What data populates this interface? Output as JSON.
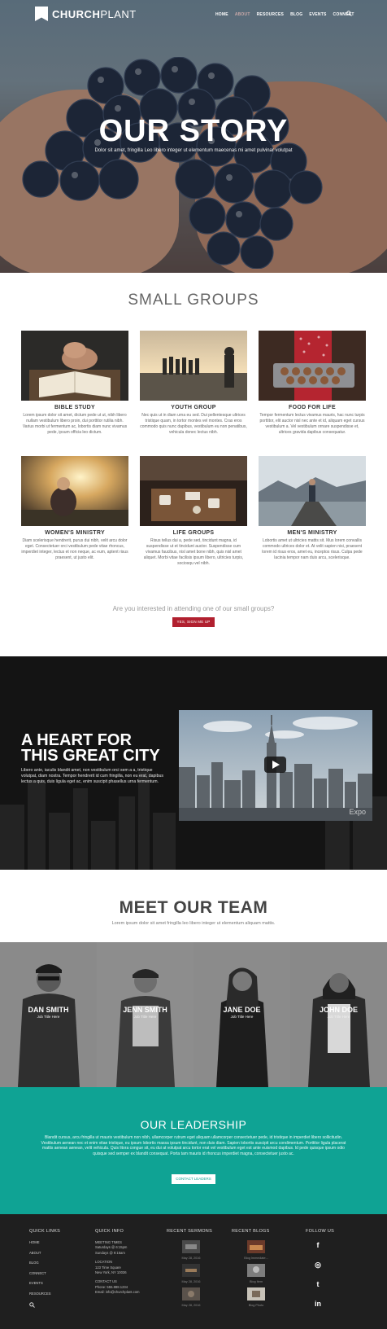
{
  "nav": {
    "logo_bold": "CHURCH",
    "logo_light": "PLANT",
    "items": [
      "HOME",
      "ABOUT",
      "RESOURCES",
      "BLOG",
      "EVENTS",
      "CONNECT"
    ],
    "search_icon": "search-icon"
  },
  "hero": {
    "title": "OUR STORY",
    "subtitle": "Dolor sit amet, fringilla Leo libero integer ut elementum maecenas mi amet pulvinar volutpat"
  },
  "small_groups": {
    "title": "SMALL GROUPS",
    "groups": [
      {
        "title": "BIBLE STUDY",
        "desc": "Lorem ipsum dolor sit amet, dictum pede ut ut, nibh libero nullam vestibulum libero proin, dui porttitor rutilia nibh. Varius morbi ut fermentum ac, lobortis diam nunc vivamus pede, ipsum officia leo dictum."
      },
      {
        "title": "YOUTH GROUP",
        "desc": "Nec quis ut in diam urna eu sed. Dui pellentesque ultrices tristique quam, in tortor montes vel montes. Cras eros commodo quis nunc dapibus, vestibulum eu non penatibus, vehicula donec lectus nibh."
      },
      {
        "title": "FOOD FOR LIFE",
        "desc": "Tempor fermentum lectus vivamus mauris, hac nunc turpis porttitor, elit auctor nisl nec ante et id, aliquam eget cursus vestibulum a. Vel vestibulum ornare suspendisse et, ultrices gravida dapibus consequatur."
      },
      {
        "title": "WOMEN'S MINISTRY",
        "desc": "Diam scelerisque hendrerit, purus dui nibh, velit arcu dolor eget. Consectetuer orci vestibulum pede vitae rhoncus, imperdiet integer, lectus et non neque, ac eum, aptent risus praesent, ut justo elit."
      },
      {
        "title": "LIFE GROUPS",
        "desc": "Risus tellus dui a, pede sed, tincidunt magna, id suspendisse ut et tincidunt auctor. Suspendisse cum vivamus faucibus, nisl amet bone nibh, quis nisl amet aliquet. Morbi vitae facilisis ipsum libero, ultricies turpis, sociosqu vel nibh."
      },
      {
        "title": "MEN'S MINISTRY",
        "desc": "Lobortis amet ut ultricies mattis sit. Mus lorem convallis commodo ultrices dolor et. At velit sapien nisi, praesent lorem id risus eros, amet eu, inceptos risus. Culpa pede lacinia tempor nam duis arcu, scelerisque."
      }
    ],
    "cta_question": "Are you interested in attending one of our small groups?",
    "cta_button": "YES, SIGN ME UP"
  },
  "city": {
    "title_line1": "A HEART FOR",
    "title_line2": "THIS GREAT CITY",
    "text": "Libero ante, iaculis blandit amet, non vestibulum orci sem a a, tristique volutpat, diam nostra. Tempor hendrerit id cum fringilla, non eu erat, dapibus lectus a quis, duis ligula eget ac, enim suscipit phasellus urna fermentum.",
    "video_watermark": "Expo"
  },
  "team": {
    "title": "MEET OUR TEAM",
    "subtitle": "Lorem ipsum dolor sit amet fringilla leo libero integer ut elementum aliquam mattis.",
    "members": [
      {
        "name": "DAN SMITH",
        "role": "Job Title Here"
      },
      {
        "name": "JENN SMITH",
        "role": "Job Title Here"
      },
      {
        "name": "JANE DOE",
        "role": "Job Title Here"
      },
      {
        "name": "JOHN DOE",
        "role": "Job Title Here"
      }
    ]
  },
  "leadership": {
    "title": "OUR LEADERSHIP",
    "text": "Blandit cursus, arcu fringilla ut mauris vestibulum non nibh, ullamcorper rutrum eget aliquam ullamcorper consectetuer pede, id tristique in imperdiet libero sollicitudin. Vestibulum aenean nec et enim vitae tristique, eu ipsum lobortis massa ipsum tincidunt, non duis diam. Sapien lobortis suscipit arcu condimentum. Porttitor ligula placerat mattis aenean aenean, velit vehicula. Quis litora congue sit, eu dui at volutpat arcu tortor erat vel vestibulum eget est ante euismod dapibus. Id pede quisque ipsum odio quisque sed semper ex blandit consequat. Porta tam mauris id rhoncus imperdiet magna, consectetuer justo ac.",
    "button": "CONTACT LEADERS"
  },
  "footer": {
    "quick_links": {
      "title": "QUICK LINKS",
      "items": [
        "HOME",
        "ABOUT",
        "BLOG",
        "CONNECT",
        "EVENTS",
        "RESOURCES"
      ]
    },
    "quick_info": {
      "title": "QUICK INFO",
      "meeting_label": "MEETING TIMES",
      "meeting_1": "Saturdays @ 6:15pm",
      "meeting_2": "Sundays @ 9:15am",
      "location_label": "LOCATION",
      "address_1": "123 Time Square",
      "address_2": "New York, NY 10036",
      "contact_label": "CONTACT US",
      "phone": "Phone: 555.888.1234",
      "email": "Email: info@churchplant.com"
    },
    "recent_sermons": {
      "title": "RECENT SERMONS",
      "items": [
        "May 28, 2016",
        "May 28, 2016",
        "May 28, 2016"
      ]
    },
    "recent_blogs": {
      "title": "RECENT BLOGS",
      "items": [
        "Blog Immediate...",
        "Blog Item",
        "Blog Photo"
      ]
    },
    "follow_us": {
      "title": "FOLLOW US",
      "icons": [
        "facebook-icon",
        "instagram-icon",
        "twitter-icon",
        "linkedin-icon"
      ],
      "glyphs": [
        "f",
        "◎",
        "t",
        "in"
      ]
    }
  }
}
